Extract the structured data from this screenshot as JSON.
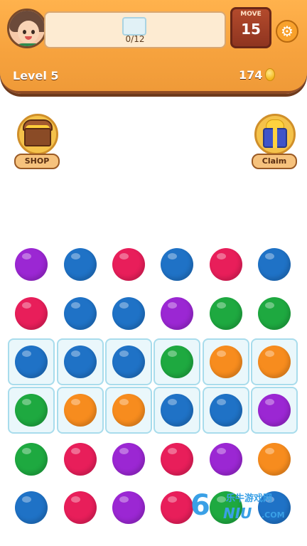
{
  "header": {
    "progress": {
      "current": 0,
      "total": 12,
      "text": "0/12"
    },
    "moves": {
      "label": "MOVE",
      "value": "15"
    },
    "level": "Level 5",
    "coins": "174",
    "icons": {
      "settings": "gear-icon",
      "coin": "coin-icon",
      "avatar": "avatar"
    }
  },
  "side_buttons": {
    "shop": {
      "label": "SHOP",
      "icon": "treasure-chest-icon"
    },
    "claim": {
      "label": "Claim",
      "icon": "gift-box-icon"
    }
  },
  "colors": {
    "purple": "#9b27d3",
    "blue": "#1f72c6",
    "red": "#e81e5a",
    "green": "#1ea940",
    "orange": "#f78c1e",
    "header": "#f7a33e",
    "frame": "#a8dcec"
  },
  "board": {
    "rows": [
      [
        "purple",
        "blue",
        "red",
        "blue",
        "red",
        "blue"
      ],
      [
        "red",
        "blue",
        "blue",
        "purple",
        "green",
        "green"
      ],
      [
        "blue",
        "blue",
        "blue",
        "green",
        "orange",
        "orange"
      ],
      [
        "green",
        "orange",
        "orange",
        "blue",
        "blue",
        "purple"
      ],
      [
        "green",
        "red",
        "purple",
        "red",
        "purple",
        "orange"
      ],
      [
        "blue",
        "red",
        "purple",
        "red",
        "green",
        "blue"
      ]
    ],
    "framed_rows": [
      2,
      3
    ]
  },
  "watermark": {
    "digit": "6",
    "cn": "乐牛游戏网",
    "en": "NIU",
    "com": ".COM"
  }
}
